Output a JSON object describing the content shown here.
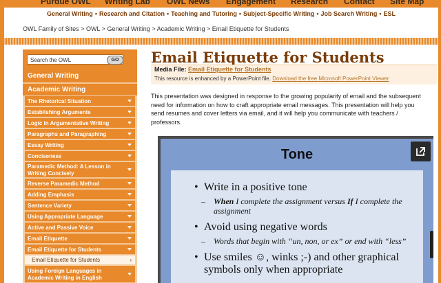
{
  "top_nav": [
    "Purdue OWL",
    "Writing Lab",
    "OWL News",
    "Engagement",
    "Research",
    "Contact",
    "Site Map"
  ],
  "sub_nav": [
    "General Writing",
    "Research and Citation",
    "Teaching and Tutoring",
    "Subject-Specific Writing",
    "Job Search Writing",
    "ESL"
  ],
  "sub_nav_sep": "•",
  "breadcrumb": {
    "items": [
      "OWL Family of Sites",
      "OWL",
      "General Writing",
      "Academic Writing",
      "Email Etiquette for Students"
    ],
    "sep": ">"
  },
  "search": {
    "placeholder": "Search the OWL",
    "go": "GO"
  },
  "sidebar": {
    "sections": [
      "General Writing",
      "Academic Writing"
    ],
    "items": [
      "The Rhetorical Situation",
      "Establishing Arguments",
      "Logic in Argumentative Writing",
      "Paragraphs and Paragraphing",
      "Essay Writing",
      "Conciseness",
      "Paramedic Method: A Lesson in Writing Concisely",
      "Reverse Paramedic Method",
      "Adding Emphasis",
      "Sentence Variety",
      "Using Appropriate Language",
      "Active and Passive Voice",
      "Email Etiquette",
      "Email Etiquette for Students",
      "Email Etiquette for Students",
      "Using Foreign Languages in Academic Writing in English"
    ],
    "active_chevron": "›"
  },
  "page": {
    "title": "Email Etiquette for Students",
    "media_label": "Media File:",
    "media_link": "Email Etiquette for Students",
    "enhanced_text": "This resource is enhanced by a PowerPoint file.",
    "download_link": "Download the free Microsoft PowerPoint Viewer",
    "intro": "This presentation was designed in response to the growing popularity of email and the subsequent need for information on how to craft appropriate email messages. This presentation will help you send resumes and cover letters via email, and it will help you communicate with teachers / professors."
  },
  "slide": {
    "title": "Tone",
    "bullet": "•",
    "dash": "–",
    "b1": "Write in a positive tone",
    "b1_sub_when": "When",
    "b1_sub_mid": " I complete the assignment versus ",
    "b1_sub_if": "If",
    "b1_sub_end": " I complete the assignment",
    "b2": "Avoid using negative words",
    "b2_sub": "Words that begin with “un, non, or ex” or end with “less”",
    "b3": "Use smiles ☺, winks ;-) and other graphical symbols only when appropriate"
  },
  "colors": {
    "brand_orange": "#e8892b",
    "title_brown": "#7a3c08",
    "link_gold": "#b5752a",
    "slide_blue": "#7f9ccf",
    "panel_blue": "#dce4f1"
  },
  "icons": [
    "expand-icon",
    "caret-down-icon"
  ]
}
